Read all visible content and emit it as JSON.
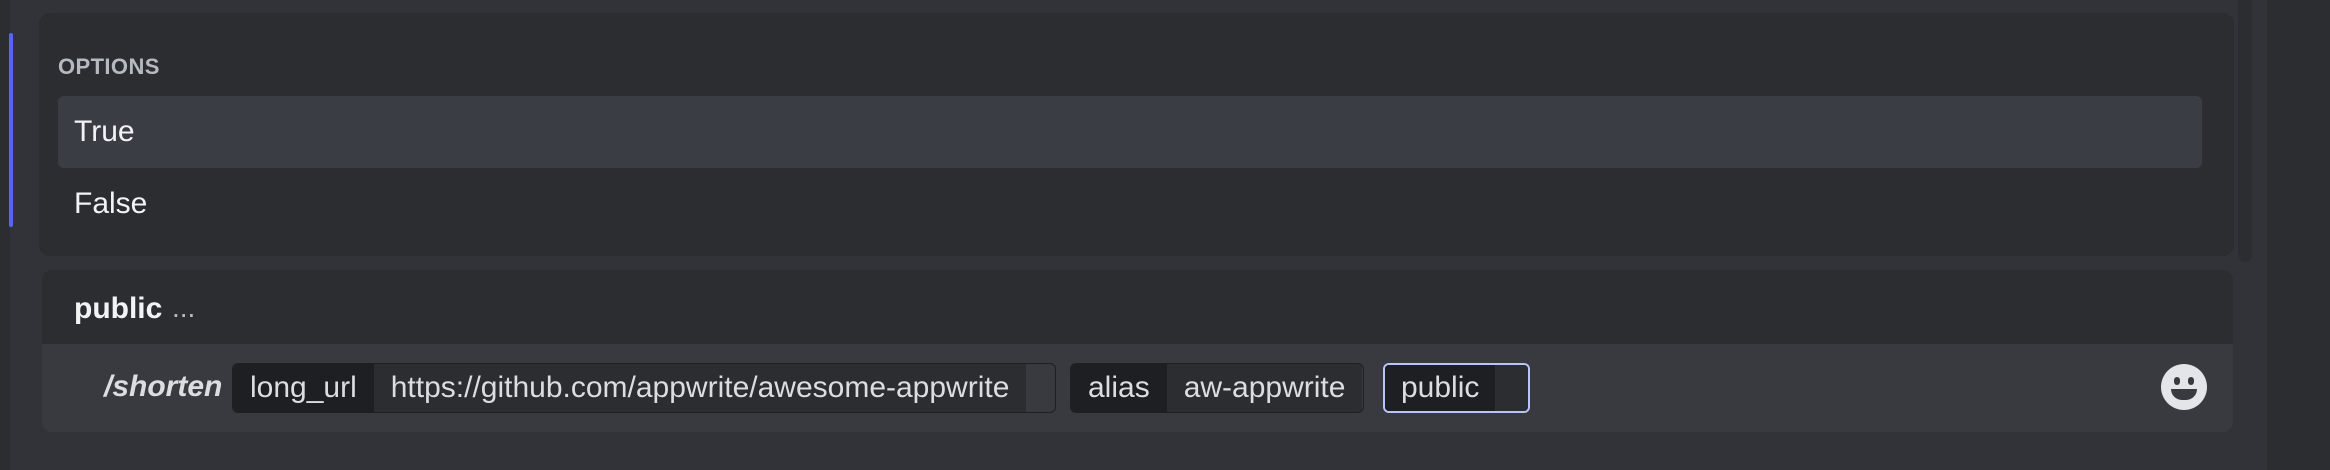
{
  "options_menu": {
    "header": "OPTIONS",
    "items": [
      {
        "label": "True",
        "highlighted": true
      },
      {
        "label": "False",
        "highlighted": false
      }
    ]
  },
  "active_option": {
    "name": "public",
    "description": "..."
  },
  "command": {
    "name": "/shorten",
    "params": [
      {
        "label": "long_url",
        "value": "https://github.com/appwrite/awesome-appwrite"
      },
      {
        "label": "alias",
        "value": "aw-appwrite"
      },
      {
        "label": "public",
        "value": ""
      }
    ]
  },
  "icons": {
    "emoji_button": "smile-emoji-icon"
  },
  "colors": {
    "accent": "#5865f2",
    "focus_border": "#b9c5f7",
    "highlight": "#3b3d44"
  }
}
